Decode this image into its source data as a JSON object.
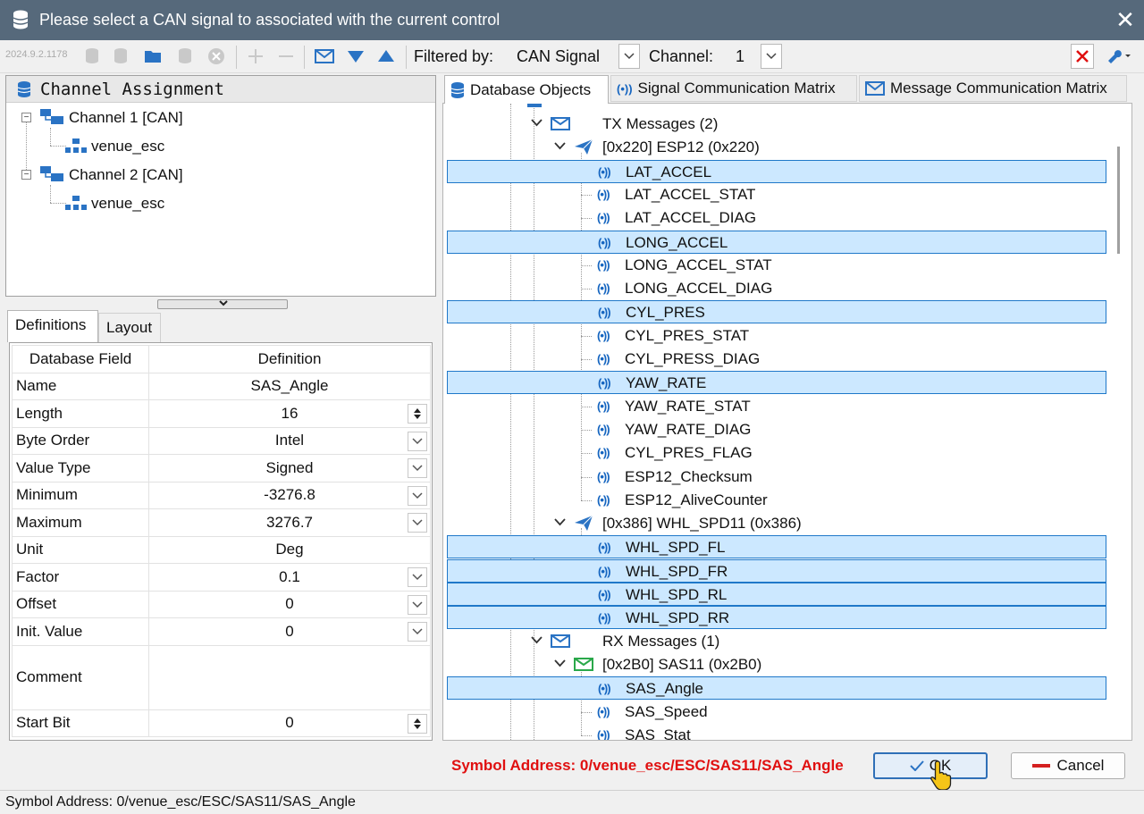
{
  "window": {
    "title": "Please select a CAN signal to associated with the current control",
    "close_glyph": "✕"
  },
  "toolbar": {
    "version": "2024.9.2.1178",
    "filter_label": "Filtered by:",
    "filter_value": "CAN Signal",
    "channel_label": "Channel:",
    "channel_value": "1"
  },
  "channel_panel": {
    "title": "Channel Assignment",
    "channels": [
      {
        "label": "Channel 1 [CAN]",
        "child": "venue_esc"
      },
      {
        "label": "Channel 2 [CAN]",
        "child": "venue_esc"
      }
    ]
  },
  "left_tabs": {
    "definitions": "Definitions",
    "layout": "Layout"
  },
  "definitions": {
    "header_field": "Database Field",
    "header_definition": "Definition",
    "rows": [
      {
        "field": "Name",
        "value": "SAS_Angle",
        "control": "none"
      },
      {
        "field": "Length",
        "value": "16",
        "control": "spin"
      },
      {
        "field": "Byte Order",
        "value": "Intel",
        "control": "drop"
      },
      {
        "field": "Value Type",
        "value": "Signed",
        "control": "drop"
      },
      {
        "field": "Minimum",
        "value": "-3276.8",
        "control": "drop"
      },
      {
        "field": "Maximum",
        "value": "3276.7",
        "control": "drop"
      },
      {
        "field": "Unit",
        "value": "Deg",
        "control": "none"
      },
      {
        "field": "Factor",
        "value": "0.1",
        "control": "drop"
      },
      {
        "field": "Offset",
        "value": "0",
        "control": "drop"
      },
      {
        "field": "Init. Value",
        "value": "0",
        "control": "drop"
      },
      {
        "field": "Comment",
        "value": "",
        "control": "none"
      },
      {
        "field": "Start Bit",
        "value": "0",
        "control": "spin"
      }
    ]
  },
  "right_tabs": {
    "database": "Database Objects",
    "signal_matrix": "Signal Communication Matrix",
    "message_matrix": "Message Communication Matrix"
  },
  "tree": {
    "tx_messages": "TX Messages (2)",
    "msg_esp12": "[0x220] ESP12 (0x220)",
    "esp12_signals": [
      {
        "name": "LAT_ACCEL",
        "selected": true
      },
      {
        "name": "LAT_ACCEL_STAT",
        "selected": false
      },
      {
        "name": "LAT_ACCEL_DIAG",
        "selected": false
      },
      {
        "name": "LONG_ACCEL",
        "selected": true
      },
      {
        "name": "LONG_ACCEL_STAT",
        "selected": false
      },
      {
        "name": "LONG_ACCEL_DIAG",
        "selected": false
      },
      {
        "name": "CYL_PRES",
        "selected": true
      },
      {
        "name": "CYL_PRES_STAT",
        "selected": false
      },
      {
        "name": "CYL_PRESS_DIAG",
        "selected": false
      },
      {
        "name": "YAW_RATE",
        "selected": true
      },
      {
        "name": "YAW_RATE_STAT",
        "selected": false
      },
      {
        "name": "YAW_RATE_DIAG",
        "selected": false
      },
      {
        "name": "CYL_PRES_FLAG",
        "selected": false
      },
      {
        "name": "ESP12_Checksum",
        "selected": false
      },
      {
        "name": "ESP12_AliveCounter",
        "selected": false
      }
    ],
    "msg_whl": "[0x386] WHL_SPD11 (0x386)",
    "whl_signals": [
      {
        "name": "WHL_SPD_FL",
        "selected": true
      },
      {
        "name": "WHL_SPD_FR",
        "selected": true
      },
      {
        "name": "WHL_SPD_RL",
        "selected": true
      },
      {
        "name": "WHL_SPD_RR",
        "selected": true
      }
    ],
    "rx_messages": "RX Messages (1)",
    "msg_sas": "[0x2B0] SAS11 (0x2B0)",
    "sas_signals": [
      {
        "name": "SAS_Angle",
        "selected": true
      },
      {
        "name": "SAS_Speed",
        "selected": false
      },
      {
        "name": "SAS_Stat",
        "selected": false
      }
    ]
  },
  "footer": {
    "symbol_address_red": "Symbol Address: 0/venue_esc/ESC/SAS11/SAS_Angle",
    "ok_label": "OK",
    "cancel_label": "Cancel",
    "status_text": "Symbol Address: 0/venue_esc/ESC/SAS11/SAS_Angle"
  },
  "colors": {
    "titlebar": "#56697b",
    "selection_bg": "#cce8ff",
    "selection_border": "#1f78c9",
    "accent_blue": "#1565c0",
    "symbol_red": "#e01010"
  }
}
